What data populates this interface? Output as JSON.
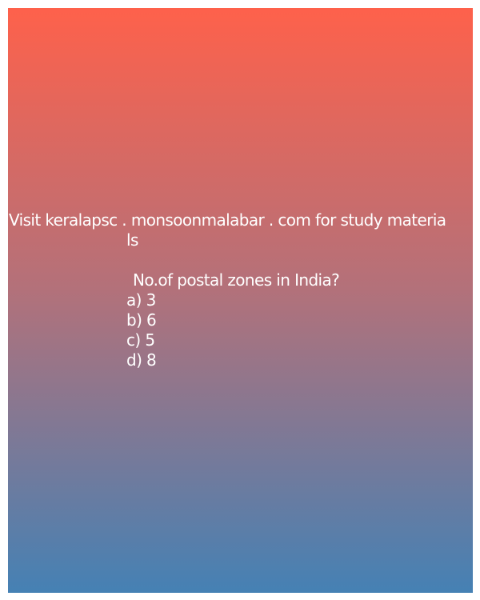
{
  "promo": {
    "line1": "Visit keralapsc . monsoonmalabar . com for study materia",
    "line2": "ls"
  },
  "question": {
    "text": "No.of postal zones in India?",
    "options": [
      "a) 3",
      "b) 6",
      "c) 5",
      "d) 8"
    ]
  },
  "colors": {
    "gradient_top": "#fe614b",
    "gradient_bottom": "#4581b4",
    "text": "#ffffff"
  }
}
